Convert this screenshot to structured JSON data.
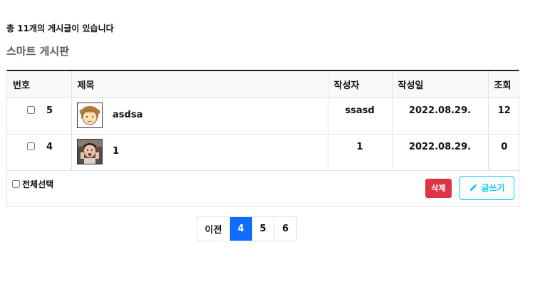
{
  "board": {
    "total_text": "총 11개의 게시글이 있습니다",
    "title": "스마트 게시판"
  },
  "table": {
    "headers": [
      "번호",
      "제목",
      "작성자",
      "작성일",
      "조회"
    ],
    "rows": [
      {
        "no": "5",
        "title": "asdsa",
        "thumb": "girl-avatar-icon",
        "writer": "ssasd",
        "date": "2022.08.29.",
        "views": "12"
      },
      {
        "no": "4",
        "title": "1",
        "thumb": "photo-thumbnail-icon",
        "writer": "1",
        "date": "2022.08.29.",
        "views": "0"
      }
    ]
  },
  "footer": {
    "select_all_label": "전체선택",
    "delete_label": "삭제",
    "write_label": "글쓰기",
    "write_icon": "pencil-icon"
  },
  "pagination": {
    "prev_label": "이전",
    "pages": [
      "4",
      "5",
      "6"
    ],
    "active_page": "4"
  },
  "colors": {
    "delete_bg": "#dc3545",
    "write_accent": "#0dcaf0",
    "active_page_bg": "#0d6efd"
  }
}
